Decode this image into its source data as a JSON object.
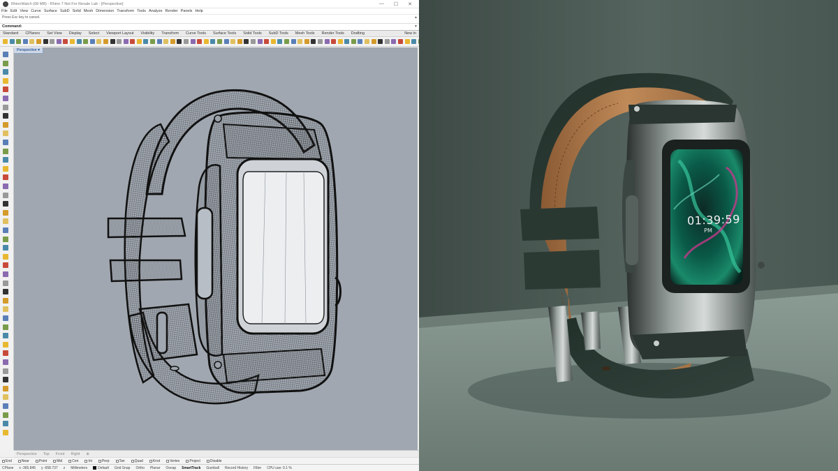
{
  "titlebar": {
    "title": "RhinoWatch (68 MB) - Rhino 7 Not For Resale Lab - [Perspective]",
    "minimize": "—",
    "maximize": "☐",
    "close": "✕"
  },
  "menu": [
    "File",
    "Edit",
    "View",
    "Curve",
    "Surface",
    "SubD",
    "Solid",
    "Mesh",
    "Dimension",
    "Transform",
    "Tools",
    "Analyze",
    "Render",
    "Panels",
    "Help"
  ],
  "command": {
    "history": "Press Esc key to cancel.",
    "prompt": "Command:"
  },
  "tabs": [
    "Standard",
    "CPlanes",
    "Set View",
    "Display",
    "Select",
    "Viewport Layout",
    "Visibility",
    "Transform",
    "Curve Tools",
    "Surface Tools",
    "Solid Tools",
    "SubD Tools",
    "Mesh Tools",
    "Render Tools",
    "Drafting",
    "New in"
  ],
  "viewport": {
    "label": "Perspective",
    "tabs": [
      "Perspective",
      "Top",
      "Front",
      "Right"
    ]
  },
  "osnap": [
    "End",
    "Near",
    "Point",
    "Mid",
    "Cen",
    "Int",
    "Perp",
    "Tan",
    "Quad",
    "Knot",
    "Vertex",
    "Project",
    "Disable"
  ],
  "status": {
    "cplane": "CPlane",
    "x": "x -365.845",
    "y": "y -658.737",
    "z": "z",
    "units": "Millimeters",
    "layer": "Default",
    "items": [
      "Grid Snap",
      "Ortho",
      "Planar",
      "Osnap",
      "SmartTrack",
      "Gumball",
      "Record History",
      "Filter",
      "CPU use: 0.1 %"
    ],
    "active_item": "SmartTrack"
  },
  "render": {
    "time": "01:39:59",
    "ampm": "PM"
  },
  "colors": {
    "viewport_bg": "#a0a7b0",
    "render_wall": "#4f5e58",
    "render_floor": "#7f9089",
    "strap_leather": "#2c3a34",
    "strap_inner": "#b07a4c"
  }
}
